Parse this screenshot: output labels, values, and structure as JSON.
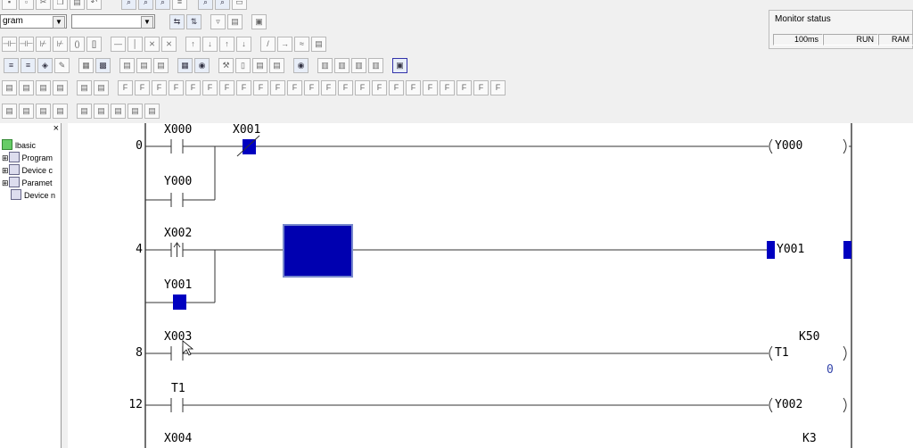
{
  "toolbar": {
    "program_combo": "gram",
    "device_combo": ""
  },
  "monitor": {
    "title": "Monitor status",
    "scan_time": "100ms",
    "mode": "RUN",
    "memory": "RAM"
  },
  "tree": {
    "close": "×",
    "items": [
      "lbasic",
      "Program",
      "Device c",
      "Paramet",
      "Device n"
    ]
  },
  "ladder": {
    "rungs": [
      {
        "step": "0",
        "contacts": [
          "X000",
          "X001",
          "Y000"
        ],
        "coil": "Y000"
      },
      {
        "step": "4",
        "contacts": [
          "X002",
          "Y001"
        ],
        "coil": "Y001"
      },
      {
        "step": "8",
        "contacts": [
          "X003"
        ],
        "coil": "T1",
        "constant": "K50",
        "current": "0"
      },
      {
        "step": "12",
        "contacts": [
          "T1"
        ],
        "coil": "Y002"
      },
      {
        "step": "",
        "contacts": [
          "X004"
        ],
        "coil": "",
        "constant": "K3"
      }
    ]
  },
  "colors": {
    "energized": "#0000c0",
    "line": "#333333",
    "rail": "#444444"
  }
}
